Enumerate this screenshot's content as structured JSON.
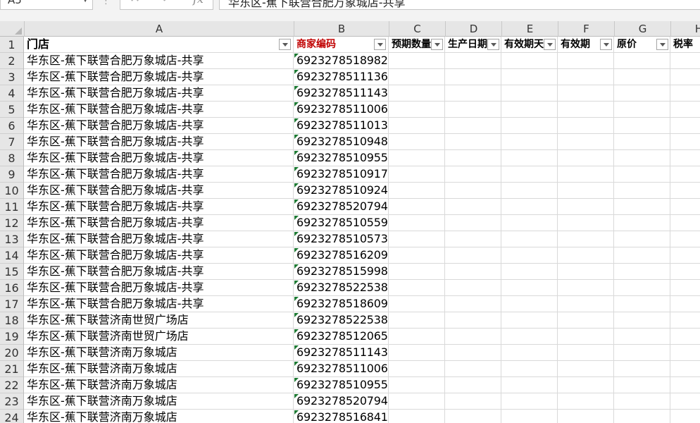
{
  "formula_bar": {
    "name_box": "A5",
    "cancel_icon": "✕",
    "enter_icon": "✓",
    "fx_label": "fx",
    "formula": "华东区-蕉下联营合肥万象城店-共享"
  },
  "columns": [
    "A",
    "B",
    "C",
    "D",
    "E",
    "F",
    "G",
    "H"
  ],
  "header_row": {
    "row_number": "1",
    "A": "门店",
    "B": "商家编码",
    "C": "预期数量",
    "D": "生产日期",
    "E": "有效期天",
    "F": "有效期",
    "G": "原价",
    "H": "税率"
  },
  "colors": {
    "header_accent": "#c00000",
    "error_triangle": "#1e7b34",
    "grid_line": "#d9d9d9",
    "header_bg": "#e6e6e6"
  },
  "rows": [
    {
      "n": "2",
      "store": "华东区-蕉下联营合肥万象城店-共享",
      "code": "6923278518982"
    },
    {
      "n": "3",
      "store": "华东区-蕉下联营合肥万象城店-共享",
      "code": "6923278511136"
    },
    {
      "n": "4",
      "store": "华东区-蕉下联营合肥万象城店-共享",
      "code": "6923278511143"
    },
    {
      "n": "5",
      "store": "华东区-蕉下联营合肥万象城店-共享",
      "code": "6923278511006"
    },
    {
      "n": "6",
      "store": "华东区-蕉下联营合肥万象城店-共享",
      "code": "6923278511013"
    },
    {
      "n": "7",
      "store": "华东区-蕉下联营合肥万象城店-共享",
      "code": "6923278510948"
    },
    {
      "n": "8",
      "store": "华东区-蕉下联营合肥万象城店-共享",
      "code": "6923278510955"
    },
    {
      "n": "9",
      "store": "华东区-蕉下联营合肥万象城店-共享",
      "code": "6923278510917"
    },
    {
      "n": "10",
      "store": "华东区-蕉下联营合肥万象城店-共享",
      "code": "6923278510924"
    },
    {
      "n": "11",
      "store": "华东区-蕉下联营合肥万象城店-共享",
      "code": "6923278520794"
    },
    {
      "n": "12",
      "store": "华东区-蕉下联营合肥万象城店-共享",
      "code": "6923278510559"
    },
    {
      "n": "13",
      "store": "华东区-蕉下联营合肥万象城店-共享",
      "code": "6923278510573"
    },
    {
      "n": "14",
      "store": "华东区-蕉下联营合肥万象城店-共享",
      "code": "6923278516209"
    },
    {
      "n": "15",
      "store": "华东区-蕉下联营合肥万象城店-共享",
      "code": "6923278515998"
    },
    {
      "n": "16",
      "store": "华东区-蕉下联营合肥万象城店-共享",
      "code": "6923278522538"
    },
    {
      "n": "17",
      "store": "华东区-蕉下联营合肥万象城店-共享",
      "code": "6923278518609"
    },
    {
      "n": "18",
      "store": "华东区-蕉下联营济南世贸广场店",
      "code": "6923278522538"
    },
    {
      "n": "19",
      "store": "华东区-蕉下联营济南世贸广场店",
      "code": "6923278512065"
    },
    {
      "n": "20",
      "store": "华东区-蕉下联营济南万象城店",
      "code": "6923278511143"
    },
    {
      "n": "21",
      "store": "华东区-蕉下联营济南万象城店",
      "code": "6923278511006"
    },
    {
      "n": "22",
      "store": "华东区-蕉下联营济南万象城店",
      "code": "6923278510955"
    },
    {
      "n": "23",
      "store": "华东区-蕉下联营济南万象城店",
      "code": "6923278520794"
    },
    {
      "n": "24",
      "store": "华东区-蕉下联营济南万象城店",
      "code": "6923278516841"
    }
  ]
}
